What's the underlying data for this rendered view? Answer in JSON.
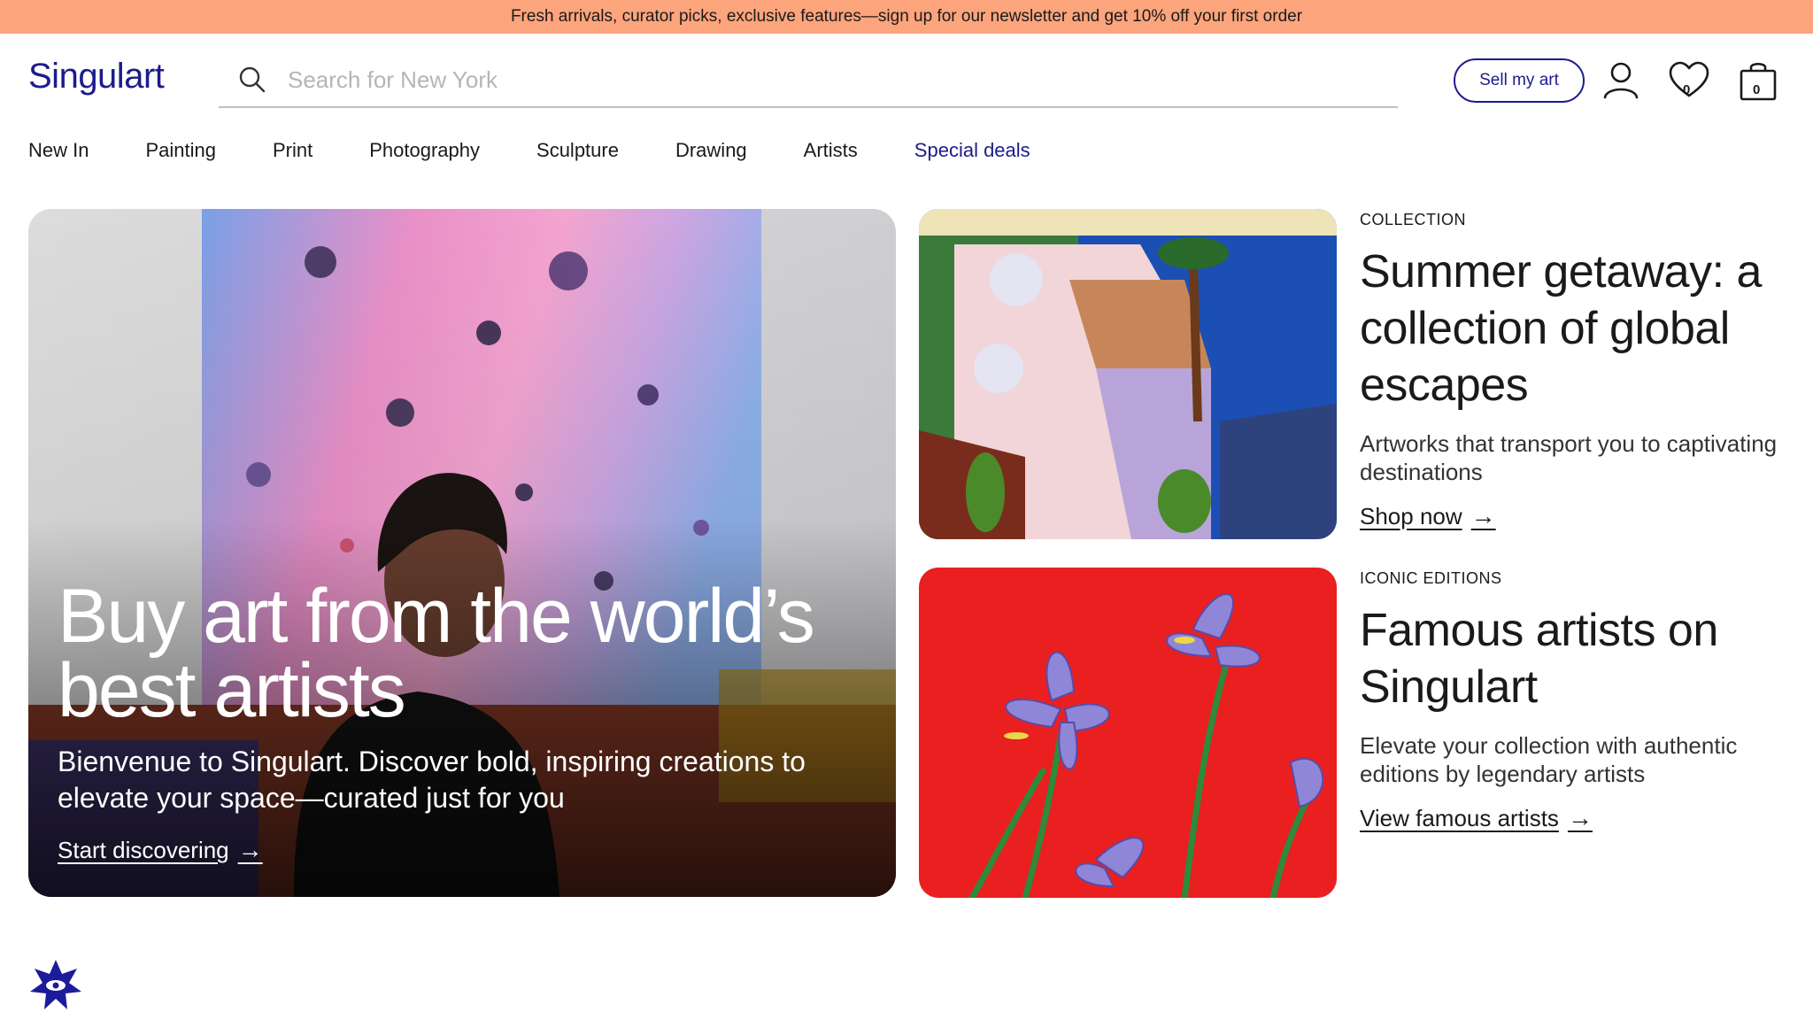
{
  "promo": {
    "text": "Fresh arrivals, curator picks, exclusive features—sign up for our newsletter and get 10% off your first order"
  },
  "header": {
    "logo": "Singulart",
    "search_placeholder": "Search for New York",
    "sell_label": "Sell my art",
    "wishlist_count": "0",
    "cart_count": "0"
  },
  "nav": {
    "items": [
      "New In",
      "Painting",
      "Print",
      "Photography",
      "Sculpture",
      "Drawing",
      "Artists",
      "Special deals"
    ]
  },
  "hero": {
    "title": "Buy art from the world’s best artists",
    "subtitle": "Bienvenue to Singulart. Discover bold, inspiring creations to elevate your space—curated just for you",
    "link": "Start discovering"
  },
  "cards": [
    {
      "eyebrow": "COLLECTION",
      "title": "Summer getaway: a collection of global escapes",
      "subtitle": "Artworks that transport you to captivating destinations",
      "link": "Shop now"
    },
    {
      "eyebrow": "ICONIC EDITIONS",
      "title": "Famous artists on Singulart",
      "subtitle": "Elevate your collection with authentic editions by legendary artists",
      "link": "View famous artists"
    }
  ],
  "colors": {
    "promo_bg": "#fca47c",
    "brand": "#1c1c8c"
  }
}
